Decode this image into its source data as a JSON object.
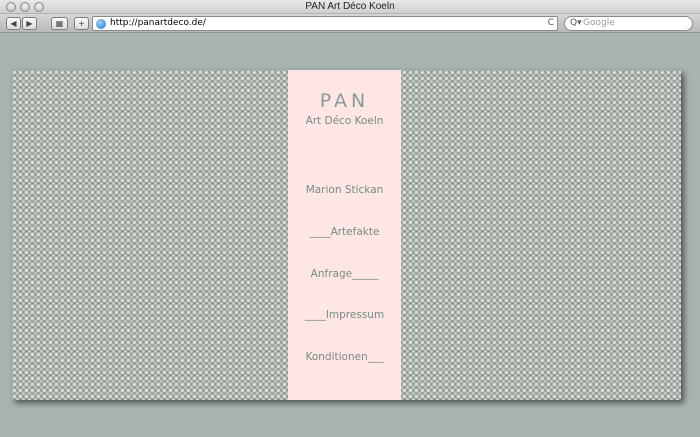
{
  "window": {
    "title": "PAN Art Déco Koeln"
  },
  "toolbar": {
    "back_glyph": "◀",
    "forward_glyph": "▶",
    "grid_glyph": "▦",
    "add_glyph": "+",
    "url": "http://panartdeco.de/",
    "reload_glyph": "C",
    "search_glyph": "Q▾",
    "search_placeholder": "Google"
  },
  "site": {
    "logo": "PAN",
    "tagline": "Art Déco Koeln",
    "nav": [
      {
        "label": "Marion Stickan"
      },
      {
        "label": "____Artefakte"
      },
      {
        "label": "Anfrage_____"
      },
      {
        "label": "____Impressum"
      },
      {
        "label": "Konditionen___"
      }
    ]
  },
  "colors": {
    "panel": "#fde6e4",
    "text": "#7b8a85",
    "page_background": "#a9b4b0",
    "texture": "#5f6e66"
  }
}
